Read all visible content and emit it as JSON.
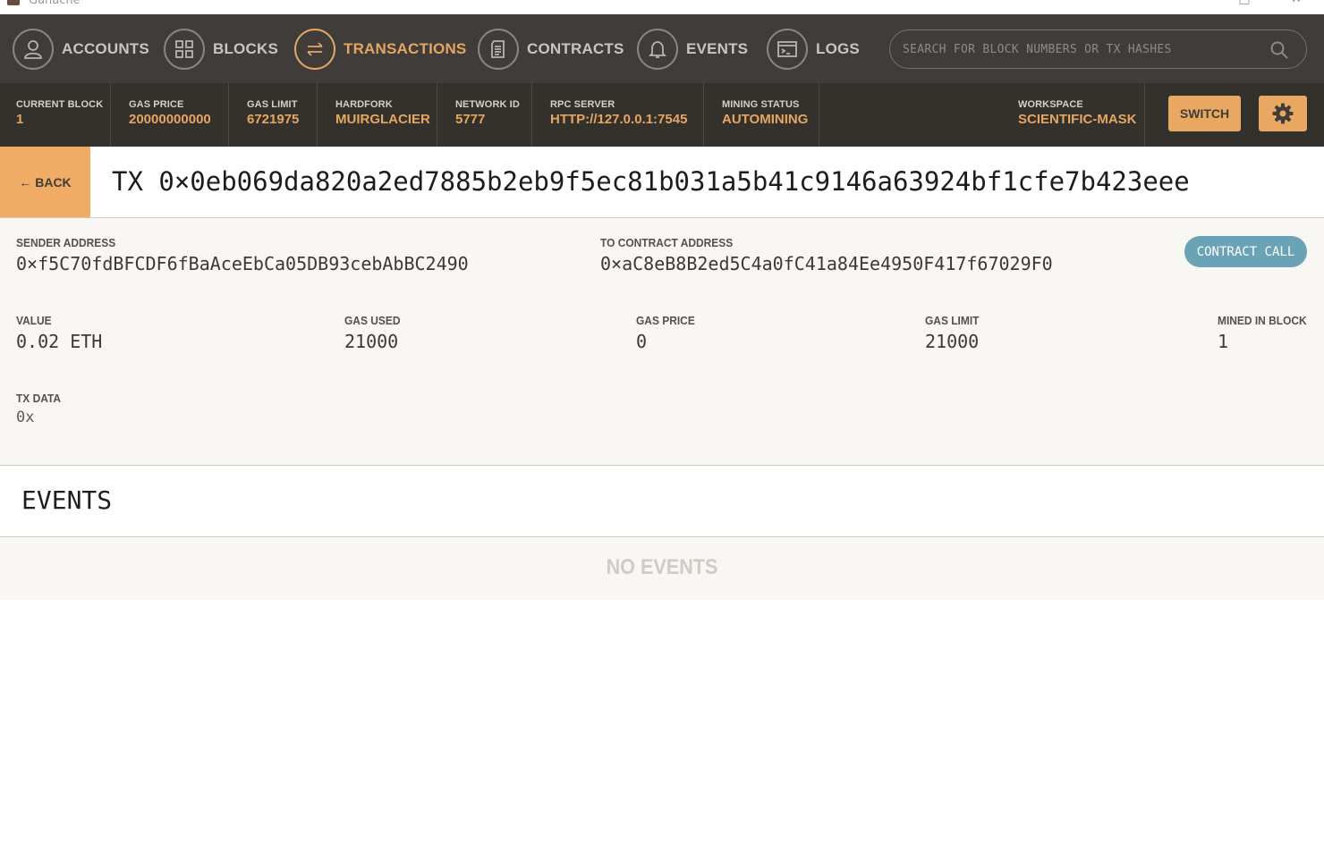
{
  "window": {
    "title": "Ganache"
  },
  "nav": {
    "items": [
      {
        "label": "ACCOUNTS",
        "icon": "user-icon",
        "active": false
      },
      {
        "label": "BLOCKS",
        "icon": "blocks-grid-icon",
        "active": false
      },
      {
        "label": "TRANSACTIONS",
        "icon": "swap-arrows-icon",
        "active": true
      },
      {
        "label": "CONTRACTS",
        "icon": "document-icon",
        "active": false
      },
      {
        "label": "EVENTS",
        "icon": "bell-icon",
        "active": false
      },
      {
        "label": "LOGS",
        "icon": "terminal-icon",
        "active": false
      }
    ],
    "search_placeholder": "SEARCH FOR BLOCK NUMBERS OR TX HASHES"
  },
  "status": {
    "current_block": {
      "label": "CURRENT BLOCK",
      "value": "1"
    },
    "gas_price": {
      "label": "GAS PRICE",
      "value": "20000000000"
    },
    "gas_limit": {
      "label": "GAS LIMIT",
      "value": "6721975"
    },
    "hardfork": {
      "label": "HARDFORK",
      "value": "MUIRGLACIER"
    },
    "network_id": {
      "label": "NETWORK ID",
      "value": "5777"
    },
    "rpc_server": {
      "label": "RPC SERVER",
      "value": "HTTP://127.0.0.1:7545"
    },
    "mining_status": {
      "label": "MINING STATUS",
      "value": "AUTOMINING"
    },
    "workspace": {
      "label": "WORKSPACE",
      "value": "SCIENTIFIC-MASK"
    },
    "switch_label": "SWITCH"
  },
  "tx": {
    "back_label": "← BACK",
    "title": "TX 0×0eb069da820a2ed7885b2eb9f5ec81b031a5b41c9146a63924bf1cfe7b423eee",
    "sender": {
      "label": "SENDER ADDRESS",
      "value": "0×f5C70fdBFCDF6fBaAceEbCa05DB93cebAbBC2490"
    },
    "to_contract": {
      "label": "TO CONTRACT ADDRESS",
      "value": "0×aC8eB8B2ed5C4a0fC41a84Ee4950F417f67029F0"
    },
    "badge": "CONTRACT CALL",
    "value": {
      "label": "VALUE",
      "value": "0.02 ETH"
    },
    "gas_used": {
      "label": "GAS USED",
      "value": "21000"
    },
    "gas_price": {
      "label": "GAS PRICE",
      "value": "0"
    },
    "gas_limit": {
      "label": "GAS LIMIT",
      "value": "21000"
    },
    "mined_in_block": {
      "label": "MINED IN BLOCK",
      "value": "1"
    },
    "tx_data": {
      "label": "TX DATA",
      "value": "0x"
    }
  },
  "events": {
    "title": "EVENTS",
    "empty_text": "NO EVENTS"
  },
  "colors": {
    "nav_bg": "#3f3c39",
    "status_bg": "#34302c",
    "accent": "#e4a663",
    "badge": "#6ba3b6"
  }
}
